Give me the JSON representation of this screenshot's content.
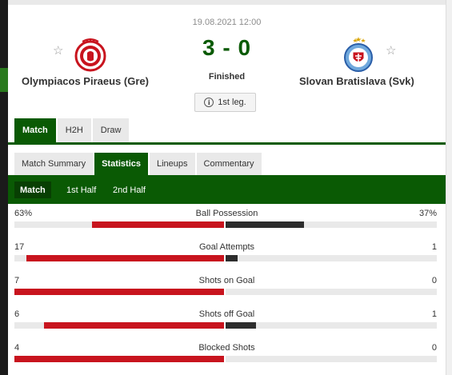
{
  "match": {
    "date": "19.08.2021 12:00",
    "score": "3 - 0",
    "status": "Finished",
    "leg": "1st leg.",
    "home_team": "Olympiacos Piraeus (Gre)",
    "away_team": "Slovan Bratislava (Svk)"
  },
  "tabs_main": [
    "Match",
    "H2H",
    "Draw"
  ],
  "tabs_section": [
    "Match Summary",
    "Statistics",
    "Lineups",
    "Commentary"
  ],
  "tabs_period": [
    "Match",
    "1st Half",
    "2nd Half"
  ],
  "colors": {
    "accent": "#0a5a04",
    "home": "#c8141e",
    "away": "#2d2d2d"
  },
  "statistics": [
    {
      "name": "Ball Possession",
      "home": "63%",
      "away": "37%",
      "home_frac": 0.63,
      "away_frac": 0.37
    },
    {
      "name": "Goal Attempts",
      "home": "17",
      "away": "1",
      "home_frac": 0.944,
      "away_frac": 0.056
    },
    {
      "name": "Shots on Goal",
      "home": "7",
      "away": "0",
      "home_frac": 1.0,
      "away_frac": 0.0
    },
    {
      "name": "Shots off Goal",
      "home": "6",
      "away": "1",
      "home_frac": 0.857,
      "away_frac": 0.143
    },
    {
      "name": "Blocked Shots",
      "home": "4",
      "away": "0",
      "home_frac": 1.0,
      "away_frac": 0.0
    }
  ]
}
